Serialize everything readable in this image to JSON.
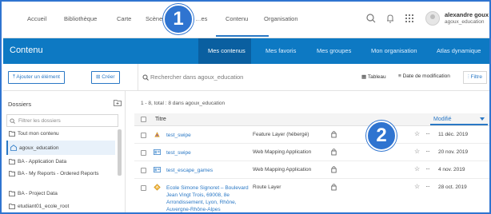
{
  "topnav": {
    "items": [
      "Accueil",
      "Bibliothèque",
      "Carte",
      "Scène",
      "…es",
      "Contenu",
      "Organisation"
    ],
    "user_name": "alexandre goux",
    "user_org": "agoux_education",
    "icons": [
      "search-icon",
      "bell-icon",
      "app-grid-icon",
      "avatar"
    ]
  },
  "badges": {
    "one": "1",
    "two": "2"
  },
  "bluebar": {
    "title": "Contenu",
    "tabs": [
      "Mes contenus",
      "Mes favoris",
      "Mes groupes",
      "Mon organisation",
      "Atlas dynamique"
    ],
    "active_tab": "Mes contenus"
  },
  "toolbar": {
    "add_label": "Ajouter un élément",
    "create_label": "Créer",
    "search_placeholder": "Rechercher dans agoux_education",
    "view_label": "Tableau",
    "sort_label": "Date de modification",
    "filter_label": "Filtre"
  },
  "sidebar": {
    "title": "Dossiers",
    "filter_placeholder": "Filtrer les dossiers",
    "folders": [
      "Tout mon contenu",
      "agoux_education",
      "BA - Application Data",
      "BA - My Reports - Ordered Reports",
      "BA - Project Data",
      "etudiant01_ecole_root"
    ]
  },
  "content": {
    "count_text": "1 - 8, total : 8 dans agoux_education",
    "col_title": "Titre",
    "col_modified": "Modifié",
    "rows": [
      {
        "title": "test_swipe",
        "type": "Feature Layer (hébergé)",
        "date": "11 déc. 2019",
        "icon": "feature-layer-icon"
      },
      {
        "title": "test_swipe",
        "type": "Web Mapping Application",
        "date": "20 nov. 2019",
        "icon": "web-app-icon"
      },
      {
        "title": "test_escape_games",
        "type": "Web Mapping Application",
        "date": "4 nov. 2019",
        "icon": "web-app-icon"
      },
      {
        "title": "Ecole Simone Signoret – Boulevard Jean Vingt Trois, 69008, 8e Arrondissement, Lyon, Rhône, Auvergne-Rhône-Alpes",
        "type": "Route Layer",
        "date": "28 oct. 2019",
        "icon": "route-layer-icon"
      }
    ]
  },
  "colors": {
    "accent": "#2a78c5",
    "bar": "#0d79c3",
    "badge": "#2f74d0"
  }
}
